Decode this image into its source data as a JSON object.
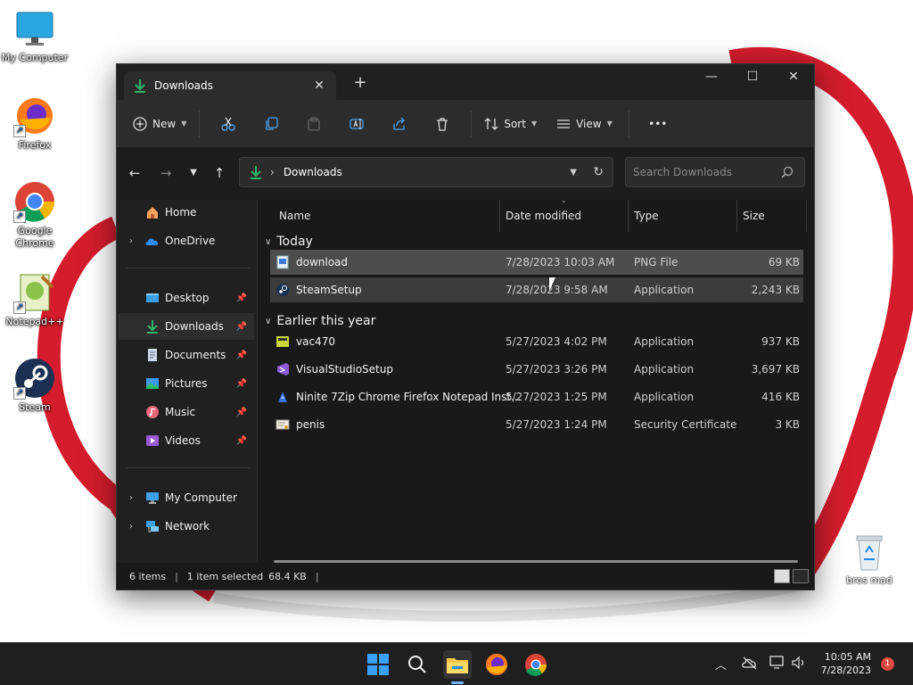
{
  "desktop": {
    "icons": [
      {
        "label": "My Computer"
      },
      {
        "label": "Firefox"
      },
      {
        "label": "Google Chrome"
      },
      {
        "label": "Notepad++"
      },
      {
        "label": "Steam"
      }
    ],
    "recycle_bin": {
      "label": "bros mad"
    }
  },
  "window": {
    "tab_title": "Downloads",
    "new_tab_symbol": "+",
    "controls": {
      "minimize": "—",
      "maximize": "☐",
      "close": "✕"
    },
    "toolbar": {
      "new_label": "New",
      "sort_label": "Sort",
      "view_label": "View",
      "more_label": "•••"
    },
    "address": {
      "crumb": "Downloads",
      "search_placeholder": "Search Downloads"
    },
    "sidebar": {
      "top": [
        {
          "label": "Home"
        },
        {
          "label": "OneDrive"
        }
      ],
      "quick": [
        {
          "label": "Desktop"
        },
        {
          "label": "Downloads"
        },
        {
          "label": "Documents"
        },
        {
          "label": "Pictures"
        },
        {
          "label": "Music"
        },
        {
          "label": "Videos"
        }
      ],
      "bottom": [
        {
          "label": "My Computer"
        },
        {
          "label": "Network"
        }
      ]
    },
    "columns": {
      "name": "Name",
      "date": "Date modified",
      "type": "Type",
      "size": "Size"
    },
    "groups": [
      {
        "label": "Today",
        "files": [
          {
            "name": "download",
            "date": "7/28/2023 10:03 AM",
            "type": "PNG File",
            "size": "69 KB"
          },
          {
            "name": "SteamSetup",
            "date": "7/28/2023 9:58 AM",
            "type": "Application",
            "size": "2,243 KB"
          }
        ]
      },
      {
        "label": "Earlier this year",
        "files": [
          {
            "name": "vac470",
            "date": "5/27/2023 4:02 PM",
            "type": "Application",
            "size": "937 KB"
          },
          {
            "name": "VisualStudioSetup",
            "date": "5/27/2023 3:26 PM",
            "type": "Application",
            "size": "3,697 KB"
          },
          {
            "name": "Ninite 7Zip Chrome Firefox Notepad Inst...",
            "date": "5/27/2023 1:25 PM",
            "type": "Application",
            "size": "416 KB"
          },
          {
            "name": "penis",
            "date": "5/27/2023 1:24 PM",
            "type": "Security Certificate",
            "size": "3 KB"
          }
        ]
      }
    ],
    "status": {
      "items": "6 items",
      "selected": "1 item selected",
      "size": "68.4 KB"
    }
  },
  "taskbar": {
    "time": "10:05 AM",
    "date": "7/28/2023",
    "notifications": "1"
  },
  "colors": {
    "accent_green": "#2fb56a",
    "selected_row": "#4d4d4d",
    "window_bg": "#191919"
  }
}
